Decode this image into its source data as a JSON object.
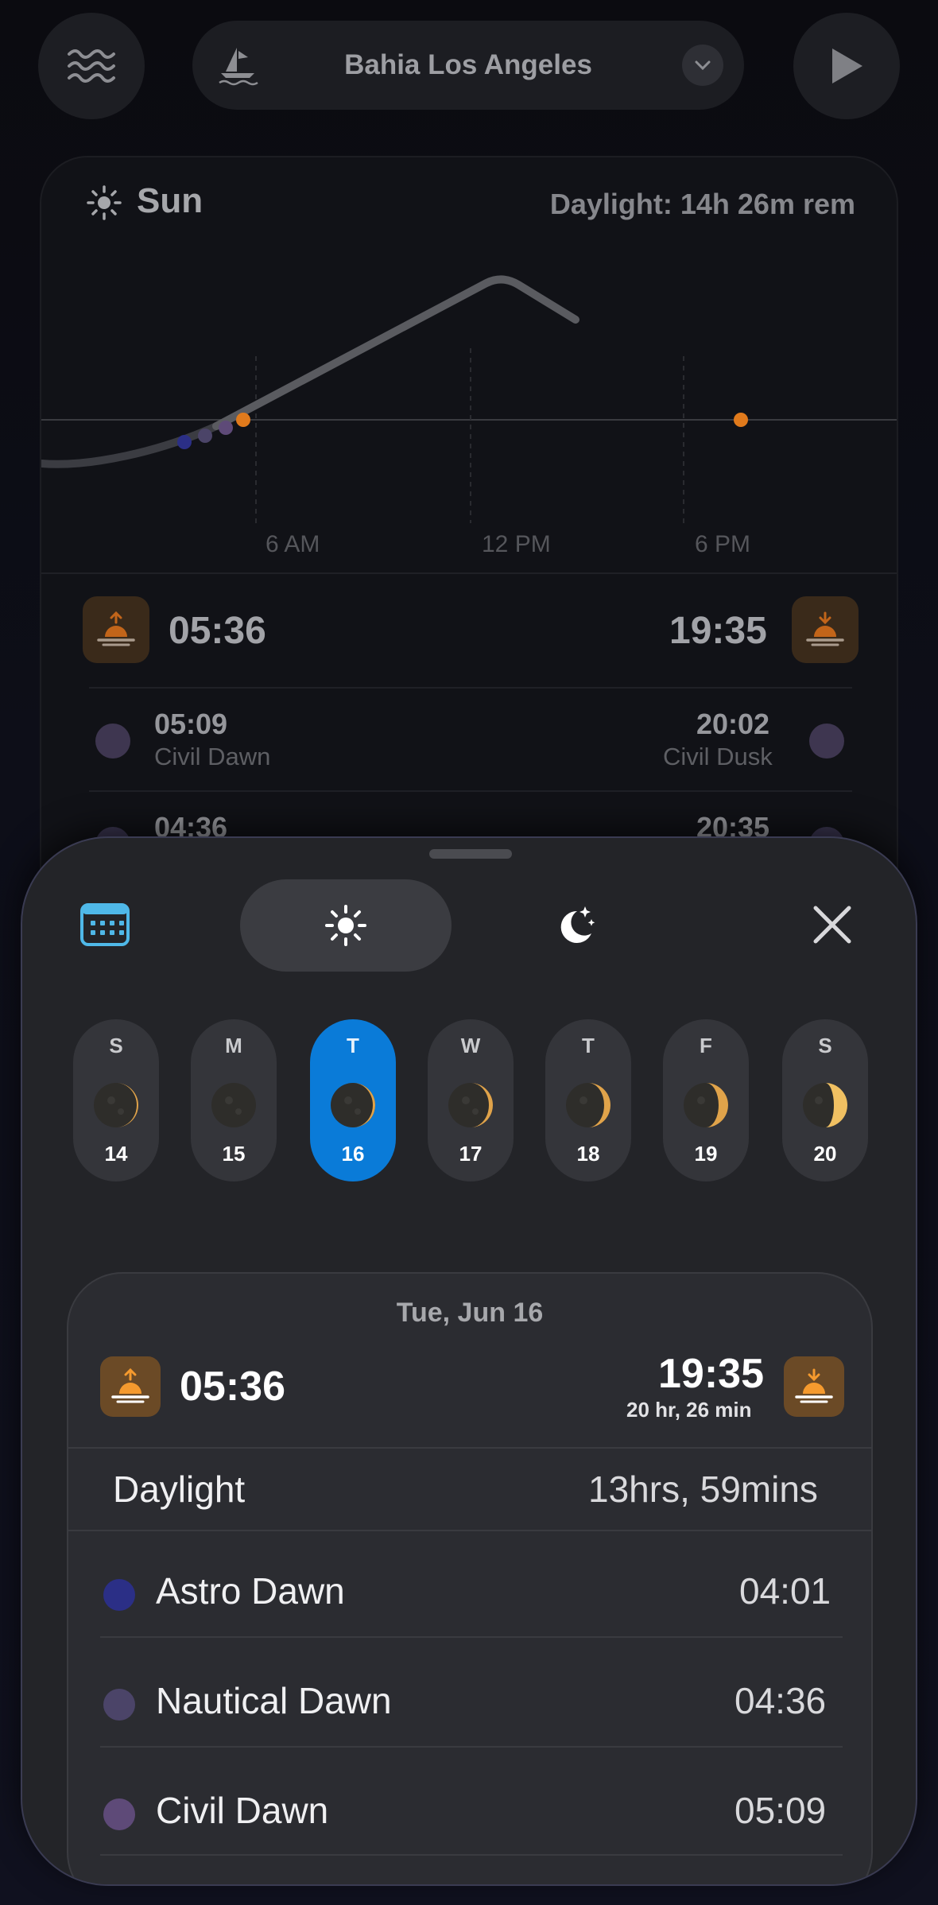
{
  "top_bar": {
    "location": "Bahia Los Angeles"
  },
  "sun_card": {
    "title": "Sun",
    "daylight_remaining": "Daylight: 14h 26m rem",
    "ticks": [
      "6 AM",
      "12 PM",
      "6 PM"
    ],
    "sunrise": "05:36",
    "sunset": "19:35",
    "civil_dawn_time": "05:09",
    "civil_dawn_label": "Civil Dawn",
    "civil_dusk_time": "20:02",
    "civil_dusk_label": "Civil Dusk",
    "nautical_dawn_time": "04:36",
    "nautical_dusk_time": "20:35"
  },
  "week": [
    {
      "letter": "S",
      "num": "14"
    },
    {
      "letter": "M",
      "num": "15"
    },
    {
      "letter": "T",
      "num": "16",
      "selected": true
    },
    {
      "letter": "W",
      "num": "17"
    },
    {
      "letter": "T",
      "num": "18"
    },
    {
      "letter": "F",
      "num": "19"
    },
    {
      "letter": "S",
      "num": "20"
    }
  ],
  "detail": {
    "date": "Tue, Jun 16",
    "sunrise": "05:36",
    "sunset": "19:35",
    "sunset_sub": "20 hr, 26 min",
    "daylight_label": "Daylight",
    "daylight_value": "13hrs, 59mins",
    "rows": [
      {
        "label": "Astro Dawn",
        "value": "04:01",
        "color": "#2b2f86"
      },
      {
        "label": "Nautical Dawn",
        "value": "04:36",
        "color": "#4b4468"
      },
      {
        "label": "Civil Dawn",
        "value": "05:09",
        "color": "#5e4a78"
      }
    ]
  },
  "colors": {
    "accent": "#0a7bd8",
    "calendar": "#4fb8e8",
    "sun_orange": "#e07a1c"
  }
}
